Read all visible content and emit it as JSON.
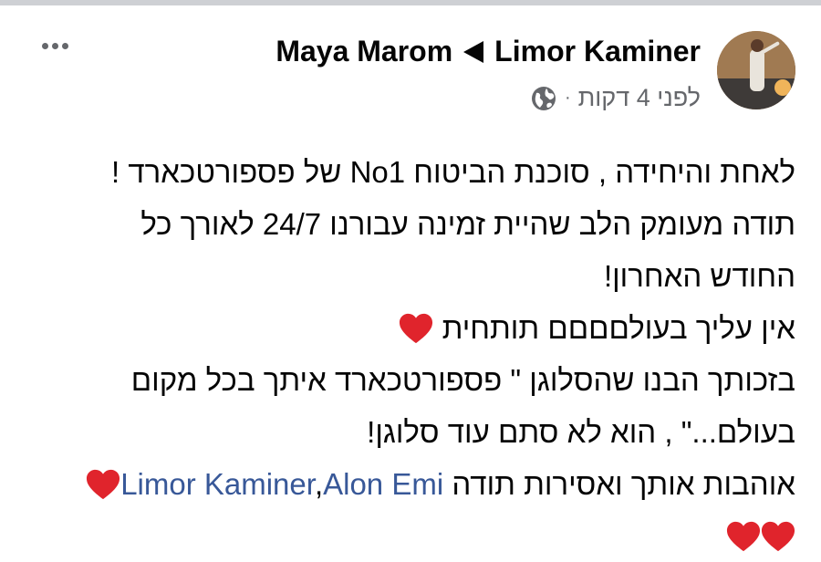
{
  "post": {
    "author": "Maya Marom",
    "target": "Limor Kaminer",
    "time": "לפני 4 דקות",
    "separator": "·",
    "lines": {
      "l1": "לאחת והיחידה , סוכנת הביטוח No1 של פספורטכארד !",
      "l2": "תודה מעומק הלב שהיית זמינה עבורנו 24/7 לאורך כל",
      "l3": "החודש האחרון!",
      "l4": "אין עליך בעולםםםם תותחית",
      "l5": "בזכותך הבנו שהסלוגן \" פספורטכארד איתך בכל מקום",
      "l6": "בעולם...\" , הוא לא סתם עוד סלוגן!",
      "l7_text": "אוהבות אותך ואסירות תודה",
      "mention1": "Limor Kaminer",
      "mention_sep": ",",
      "mention2": "Alon Emi"
    }
  },
  "icons": {
    "globe": "globe-icon",
    "heart": "heart-icon",
    "more": "more-options-icon",
    "arrow": "triangle-right-icon"
  },
  "colors": {
    "text": "#050505",
    "secondary": "#65676b",
    "mention": "#385898",
    "heart": "#e0242c"
  }
}
